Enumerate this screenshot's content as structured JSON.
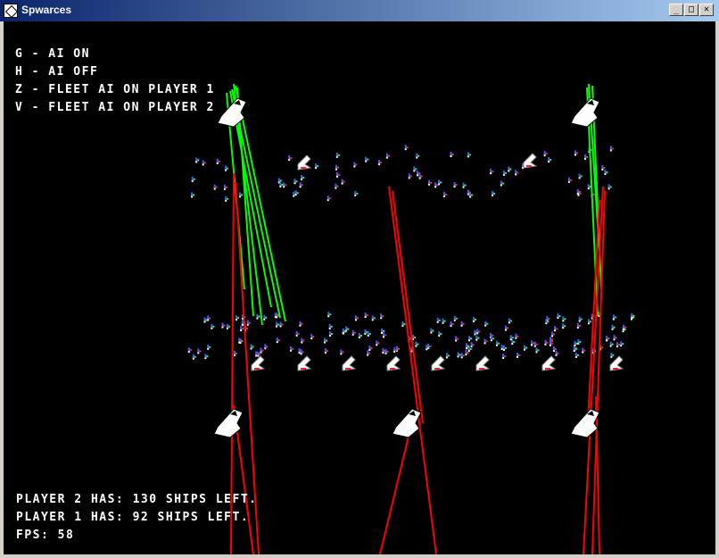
{
  "window": {
    "title": "Spwarces",
    "minimize_glyph": "_",
    "maximize_glyph": "□",
    "close_glyph": "✕",
    "icon": "game-app-icon"
  },
  "help": {
    "lines": [
      "G - AI ON",
      "H - AI OFF",
      "Z - FLEET AI ON PLAYER 1",
      "V - FLEET AI ON PLAYER 2"
    ]
  },
  "status": {
    "player2": "PLAYER 2 HAS: 130 SHIPS LEFT.",
    "player1": "PLAYER 1 HAS: 92 SHIPS LEFT.",
    "fps": "FPS: 58"
  },
  "colors": {
    "background": "#000000",
    "player1_laser": "#ff0000",
    "player2_laser": "#00ff00",
    "text": "#ffffff",
    "ship_body": "#ffffff",
    "fighter_blue": "#3a5fff"
  }
}
